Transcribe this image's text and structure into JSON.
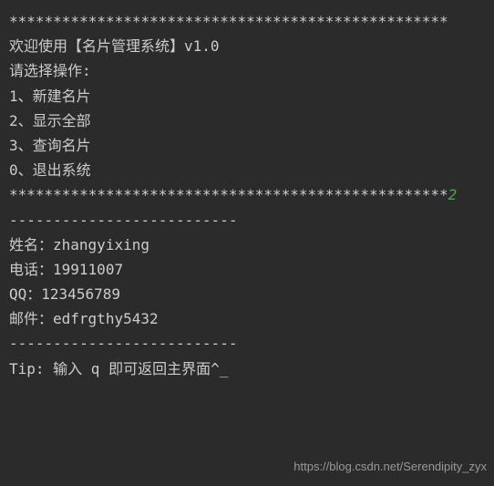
{
  "header_stars": "**************************************************",
  "welcome": "欢迎使用【名片管理系统】v1.0",
  "blank": "",
  "prompt": "请选择操作:",
  "menu": {
    "item1": "1、新建名片",
    "item2": "2、显示全部",
    "item3": "3、查询名片",
    "item0": "0、退出系统"
  },
  "footer_stars": "**************************************************",
  "user_input": "2",
  "dashes": "--------------------------",
  "card": {
    "name_label": "姓名：",
    "name_value": "zhangyixing",
    "phone_label": "电话：",
    "phone_value": "19911007",
    "qq_label": "QQ：",
    "qq_value": "123456789",
    "email_label": "邮件：",
    "email_value": "edfrgthy5432"
  },
  "tip": "Tip: 输入 q 即可返回主界面^_",
  "watermark": "https://blog.csdn.net/Serendipity_zyx"
}
